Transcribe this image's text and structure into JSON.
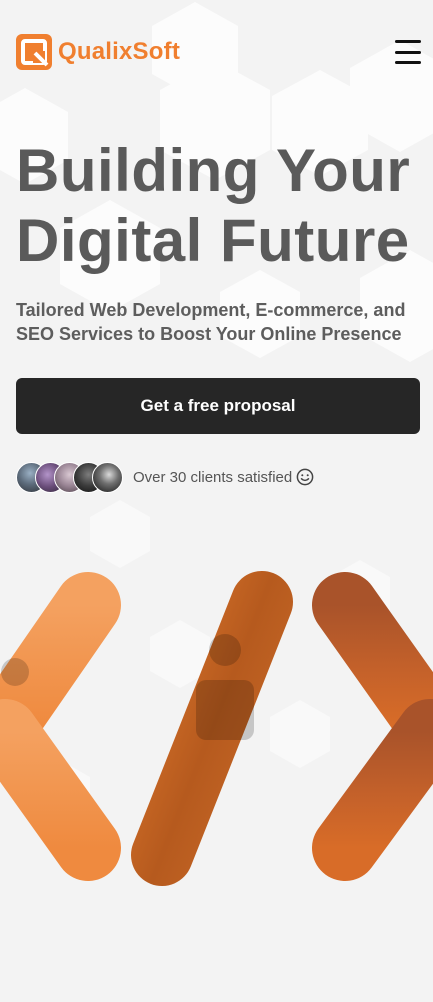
{
  "brand": {
    "name": "QualixSoft",
    "accent": "#f07f2f"
  },
  "header": {
    "menu_icon": "hamburger-menu-icon"
  },
  "hero": {
    "title_line1": "Building Your",
    "title_line2": "Digital Future",
    "subtitle": "Tailored Web Development, E-commerce, and SEO Services to Boost Your Online Presence",
    "cta_label": "Get a free proposal"
  },
  "clients": {
    "text": "Over 30 clients satisfied",
    "icon": "smiley-icon",
    "avatar_count": 5
  },
  "illustration": {
    "glyph": "code-brackets-icon"
  }
}
